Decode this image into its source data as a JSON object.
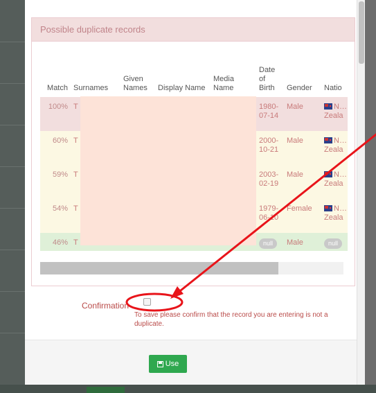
{
  "panel": {
    "title": "Possible duplicate records"
  },
  "table": {
    "headers": [
      "Match",
      "Surnames",
      "Given Names",
      "Display Name",
      "Media Name",
      "Date of Birth",
      "Gender",
      "Natio"
    ],
    "rows": [
      {
        "match": "100%",
        "surname": "T",
        "dob": "1980-07-14",
        "gender": "Male",
        "nationality": "N… Zeala",
        "style": "red"
      },
      {
        "match": "60%",
        "surname": "T",
        "dob": "2000-10-21",
        "gender": "Male",
        "nationality": "N… Zeala",
        "style": "yel"
      },
      {
        "match": "59%",
        "surname": "T",
        "dob": "2003-02-19",
        "gender": "Male",
        "nationality": "N… Zeala",
        "style": "yel"
      },
      {
        "match": "54%",
        "surname": "T",
        "dob": "1979-06-10",
        "gender": "Female",
        "nationality": "N… Zeala",
        "style": "yel"
      },
      {
        "match": "46%",
        "surname": "T",
        "dob": "null",
        "gender": "Male",
        "nationality": "null",
        "style": "grn"
      }
    ]
  },
  "confirmation": {
    "label": "Confirmation",
    "help": "To save please confirm that the record you are entering is not a duplicate."
  },
  "footer": {
    "use_label": "Use"
  },
  "colors": {
    "annotation": "#e8141a",
    "danger": "#b94a48",
    "success": "#2fa84f"
  }
}
